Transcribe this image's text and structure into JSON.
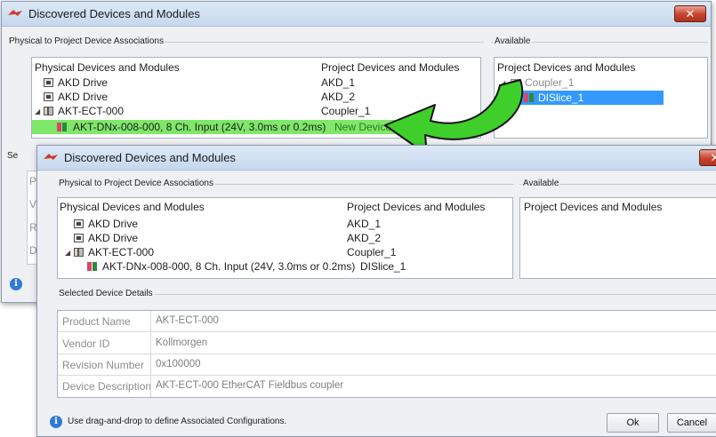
{
  "back_dialog": {
    "title": "Discovered Devices and Modules",
    "close_glyph": "✕",
    "associations_label": "Physical to Project Device Associations",
    "available_label": "Available",
    "columns": {
      "physical": "Physical Devices and Modules",
      "project": "Project Devices and Modules"
    },
    "rows": [
      {
        "icon": "drive-icon",
        "physical": "AKD Drive",
        "project": "AKD_1"
      },
      {
        "icon": "drive-icon",
        "physical": "AKD Drive",
        "project": "AKD_2"
      },
      {
        "icon": "coupler-icon",
        "physical": "AKT-ECT-000",
        "project": "Coupler_1",
        "expander": "◢"
      },
      {
        "icon": "input-module-icon",
        "physical": "AKT-DNx-008-000, 8 Ch. Input (24V, 3.0ms or 0.2ms)",
        "project": "New Device",
        "highlight": "#7fe76a"
      }
    ],
    "available": {
      "column": "Project Devices and Modules",
      "items": [
        {
          "label": "Coupler_1",
          "expander": "◢"
        },
        {
          "label": "DISlice_1",
          "selected_color": "#3399ff"
        }
      ]
    },
    "peek_letters": [
      "Se",
      "P",
      "V",
      "R",
      "D"
    ]
  },
  "front_dialog": {
    "title": "Discovered Devices and Modules",
    "close_glyph": "✕",
    "associations_label": "Physical to Project Device Associations",
    "available_label": "Available",
    "columns": {
      "physical": "Physical Devices and Modules",
      "project": "Project Devices and Modules"
    },
    "rows": [
      {
        "icon": "drive-icon",
        "physical": "AKD Drive",
        "project": "AKD_1"
      },
      {
        "icon": "drive-icon",
        "physical": "AKD Drive",
        "project": "AKD_2"
      },
      {
        "icon": "coupler-icon",
        "physical": "AKT-ECT-000",
        "project": "Coupler_1",
        "expander": "◢"
      },
      {
        "icon": "input-module-icon",
        "physical": "AKT-DNx-008-000, 8 Ch. Input (24V, 3.0ms or 0.2ms)",
        "project": "DISlice_1"
      }
    ],
    "available_column": "Project Devices and Modules",
    "details_label": "Selected Device Details",
    "details": [
      {
        "label": "Product Name",
        "value": "AKT-ECT-000"
      },
      {
        "label": "Vendor ID",
        "value": "Kollmorgen"
      },
      {
        "label": "Revision Number",
        "value": "0x100000"
      },
      {
        "label": "Device Description",
        "value": "AKT-ECT-000 EtherCAT Fieldbus coupler"
      }
    ],
    "hint": "Use drag-and-drop to define Associated Configurations.",
    "ok_label": "Ok",
    "cancel_label": "Cancel"
  },
  "colors": {
    "drag_arrow": "#3fcf2a",
    "selection": "#3399ff",
    "title_icon": "#d33a2a"
  }
}
